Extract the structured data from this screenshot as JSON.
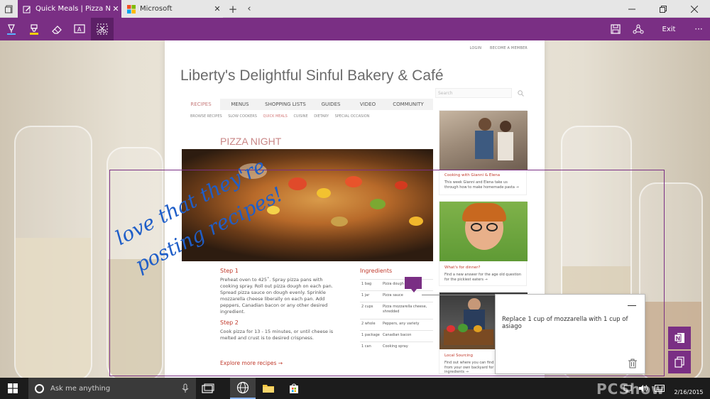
{
  "browser": {
    "tabs": [
      {
        "label": "Quick Meals | Pizza Night",
        "active": true,
        "icon": "pen-note-icon",
        "close": "✕"
      },
      {
        "label": "Microsoft",
        "active": false,
        "icon": "microsoft-logo-icon",
        "close": "✕"
      }
    ],
    "new_tab": "+",
    "back": "‹"
  },
  "ink_toolbar": {
    "tools": [
      "pen-icon",
      "highlighter-icon",
      "eraser-icon",
      "typed-note-icon",
      "clip-icon"
    ],
    "exit_label": "Exit",
    "more": "···",
    "accent": "#7a2f84"
  },
  "site": {
    "top_links": [
      "LOGIN",
      "BECOME A MEMBER"
    ],
    "title": "Liberty's Delightful Sinful Bakery & Café",
    "search_placeholder": "Search",
    "nav": [
      "RECIPES",
      "MENUS",
      "SHOPPING LISTS",
      "GUIDES",
      "VIDEO",
      "COMMUNITY"
    ],
    "subnav": [
      "BROWSE RECIPES",
      "SLOW COOKERS",
      "QUICK MEALS",
      "CUISINE",
      "DIETARY",
      "SPECIAL OCCASION"
    ],
    "section_title": "PIZZA NIGHT",
    "steps": [
      {
        "title": "Step 1",
        "text": "Preheat oven to 425˚. Spray pizza pans with cooking spray. Roll out pizza dough on each pan. Spread pizza sauce on dough evenly. Sprinkle mozzarella cheese liberally on each pan. Add peppers, Canadian bacon or any other desired ingredient."
      },
      {
        "title": "Step 2",
        "text": "Cook pizza for 13 - 15 minutes, or until cheese is melted and  crust is to desired crispness."
      }
    ],
    "ingredients_title": "Ingredients",
    "ingredients": [
      {
        "qty": "1 bag",
        "name": "Pizza dough"
      },
      {
        "qty": "1 jar",
        "name": "Pizza sauce"
      },
      {
        "qty": "2 cups",
        "name": "Pizza mozzarella cheese, shredded"
      },
      {
        "qty": "2 whole",
        "name": "Peppers, any variety"
      },
      {
        "qty": "1 package",
        "name": "Canadian bacon"
      },
      {
        "qty": "1 can",
        "name": "Cooking spray"
      }
    ],
    "explore_link": "Explore more recipes →",
    "sidebar_cards": [
      {
        "title": "Cooking with Gianni & Elena",
        "text": "This week Gianni and Elena take us through how to make homemade pasta →"
      },
      {
        "title": "What's for dinner?",
        "text": "Find a new answer for the age old question for the pickiest eaters →"
      },
      {
        "title": "Local Sourcing",
        "text": "Find out where you can find everything from your own backyard for fresher ingredients →"
      }
    ]
  },
  "annotation": {
    "handwriting_line1": "love that they're",
    "handwriting_line2": "posting recipes!",
    "note_text": "Replace 1 cup of mozzarella with 1 cup of asiago"
  },
  "side_buttons": [
    "onenote-icon",
    "copy-icon"
  ],
  "taskbar": {
    "search_placeholder": "Ask me anything",
    "watermark": "PCShow",
    "time": "2/16/2015"
  }
}
